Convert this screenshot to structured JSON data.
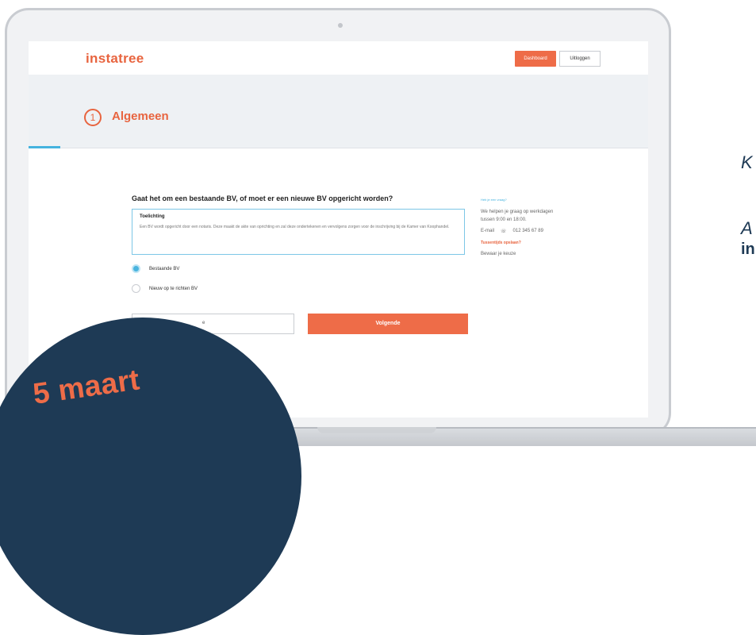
{
  "app": {
    "logo": "instatree"
  },
  "header": {
    "dashboard_label": "Dashboard",
    "logout_label": "Uitloggen"
  },
  "step": {
    "number": "1",
    "title": "Algemeen"
  },
  "form": {
    "question": "Gaat het om een bestaande BV, of moet er een nieuwe BV opgericht worden?",
    "explanation_title": "Toelichting",
    "explanation_text": "Een BV wordt opgericht door een notaris. Deze maakt de akte van oprichting en zal deze ondertekenen en vervolgens zorgen voor de inschrijving bij de Kamer van Koophandel.",
    "options": [
      {
        "label": "Bestaande BV",
        "checked": true
      },
      {
        "label": "Nieuw op te richten BV",
        "checked": false
      }
    ],
    "input_value": "e",
    "next_label": "Volgende"
  },
  "side": {
    "question_link": "Heb je een vraag?",
    "help_text": "We helpen je graag op werkdagen tussen 9:00 en 18:00.",
    "email_label": "E-mail",
    "phone": "012 345 67 89",
    "save_label": "Tussentijds opslaan?",
    "keep_label": "Bewaar je keuze"
  },
  "promo": {
    "date": "5 maart"
  },
  "cutoff": {
    "k": "K",
    "a": "A",
    "in": "in"
  },
  "colors": {
    "accent": "#ee6c48",
    "navy": "#1e3a55",
    "blue": "#45b3df"
  }
}
